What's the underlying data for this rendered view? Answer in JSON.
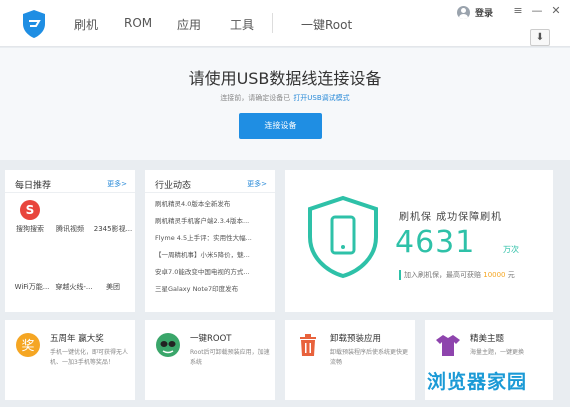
{
  "nav": {
    "items": [
      "刷机",
      "ROM",
      "应用",
      "工具"
    ],
    "root": "一键Root"
  },
  "account": {
    "login": "登录"
  },
  "window": {
    "menu": "≡",
    "minimize": "—",
    "close": "✕",
    "download": "⬇"
  },
  "hero": {
    "title": "请使用USB数据线连接设备",
    "subtitle": "连接前，请确定设备已",
    "subtitle_link": "打开USB调试模式",
    "button": "连接设备"
  },
  "daily": {
    "title": "每日推荐",
    "more": "更多>",
    "apps": [
      {
        "label": "搜狗搜索",
        "icon": "sogou-icon"
      },
      {
        "label": "腾讯视频",
        "icon": "tencent-video-icon"
      },
      {
        "label": "2345影视...",
        "icon": "video-icon"
      },
      {
        "label": "WiFi万能...",
        "icon": "wifi-icon"
      },
      {
        "label": "穿越火线-...",
        "icon": "game-icon"
      },
      {
        "label": "美团",
        "icon": "meituan-icon"
      }
    ]
  },
  "industry": {
    "title": "行业动态",
    "more": "更多>",
    "items": [
      "刷机精灵4.0版本全新发布",
      "刷机精灵手机客户端2.3.4版本...",
      "Flyme 4.5上手评：实用性大幅...",
      "【一周精机事】小米5降价，魅...",
      "安卓7.0能改变中国电视的方式...",
      "三星Galaxy Note7印度发布"
    ]
  },
  "stat": {
    "title": "刷机保  成功保障刷机",
    "number": "4631",
    "unit": "万次",
    "note_prefix": "加入刷机保，最高可获赔",
    "note_amount": "10000",
    "note_suffix": "元"
  },
  "features": [
    {
      "title": "五周年 赢大奖",
      "desc": "手机一键优化，即可获得无人机、一加3手机等奖品！",
      "icon": "anniversary-icon"
    },
    {
      "title": "一键ROOT",
      "desc": "Root后可卸载预装应用，加速系统",
      "icon": "root-icon"
    },
    {
      "title": "卸载预装应用",
      "desc": "卸载预装程序后使系统更快更流畅",
      "icon": "trash-icon"
    },
    {
      "title": "精美主题",
      "desc": "海量主题，一键更换",
      "icon": "shirt-icon"
    }
  ],
  "watermark": "浏览器家园",
  "colors": {
    "accent": "#1f8ee3",
    "green": "#2ec1a8",
    "orange": "#f5a623"
  }
}
